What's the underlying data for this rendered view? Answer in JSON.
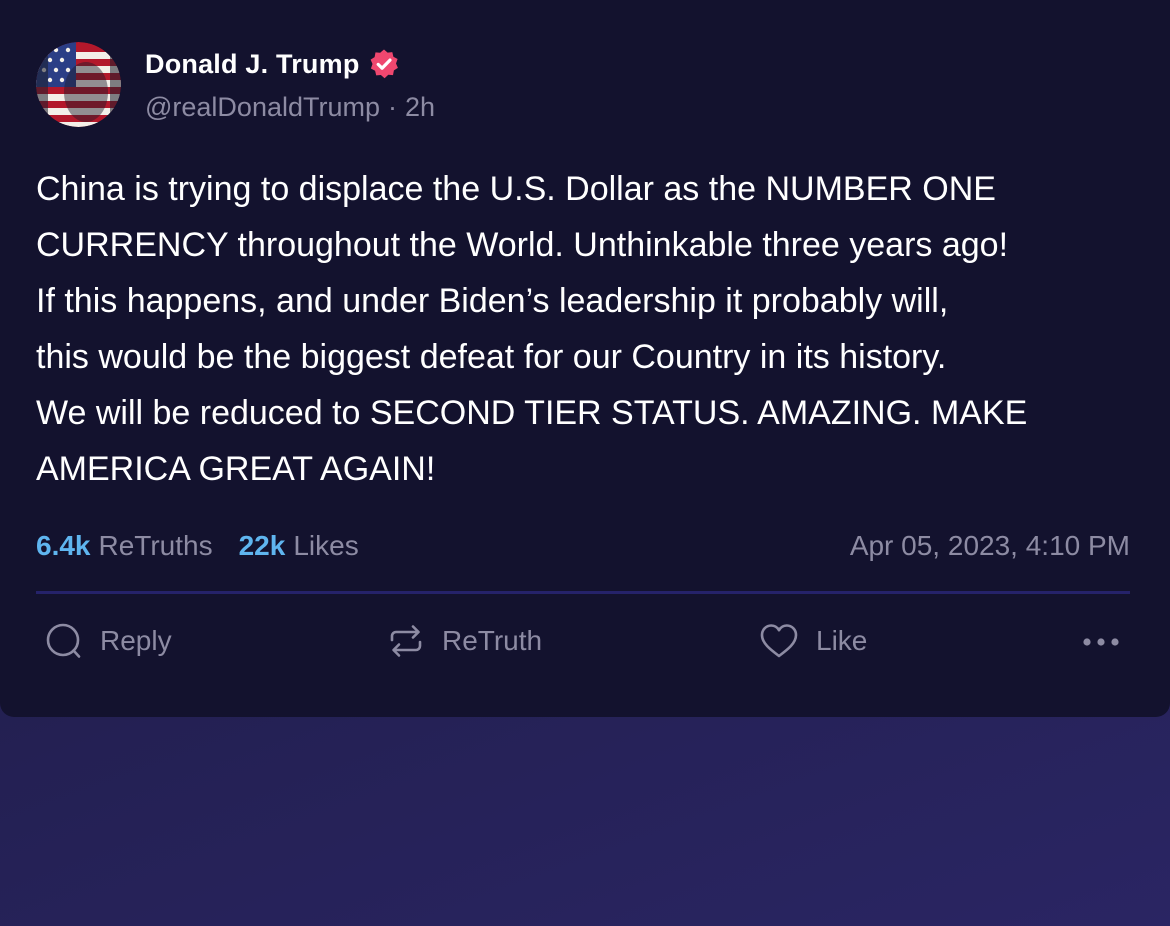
{
  "post": {
    "author_name": "Donald J. Trump",
    "handle": "@realDonaldTrump",
    "separator": "·",
    "time_ago": "2h",
    "body": "China is trying to displace the U.S. Dollar as the NUMBER ONE\nCURRENCY throughout the World. Unthinkable three years ago!\nIf this happens, and under Biden’s leadership it probably will,\nthis would be the biggest defeat for our Country in its history.\nWe will be reduced to SECOND TIER STATUS. AMAZING. MAKE\nAMERICA GREAT AGAIN!",
    "stats": {
      "retruths_count": "6.4k",
      "retruths_label": "ReTruths",
      "likes_count": "22k",
      "likes_label": "Likes"
    },
    "timestamp": "Apr 05, 2023, 4:10 PM",
    "actions": {
      "reply_label": "Reply",
      "retruth_label": "ReTruth",
      "like_label": "Like"
    },
    "icons": {
      "avatar": "avatar-image",
      "verified": "verified-badge-icon",
      "reply": "reply-icon",
      "retruth": "retruth-icon",
      "like": "heart-icon",
      "more": "more-icon"
    }
  },
  "colors": {
    "card_background": "#13122e",
    "page_background": "#221f4f",
    "stat_accent": "#5fb5ef",
    "muted_text": "#8d8ba3",
    "verified_badge": "#ef476f",
    "divider": "#25226a"
  }
}
